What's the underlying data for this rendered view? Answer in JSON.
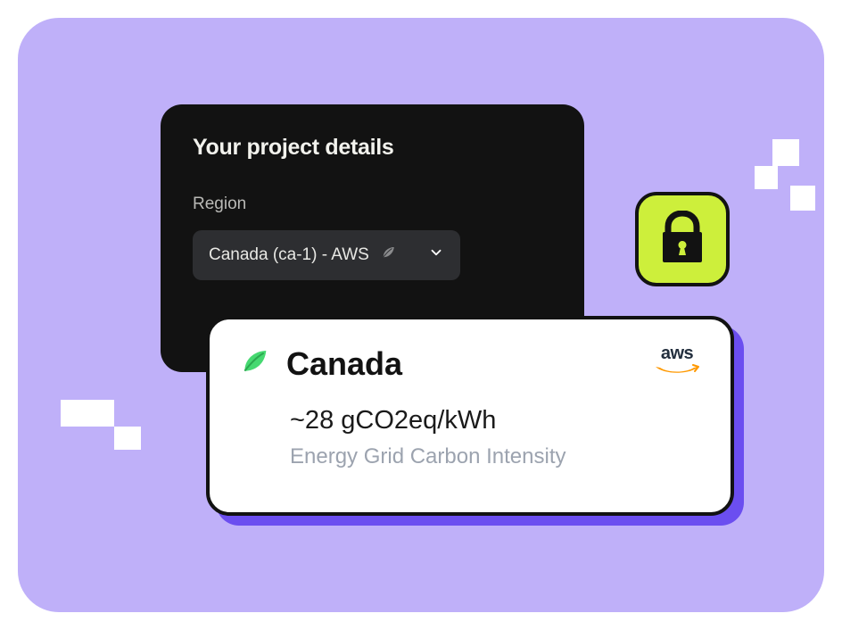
{
  "panel": {
    "title": "Your project details",
    "region_label": "Region",
    "region_value": "Canada (ca-1) - AWS"
  },
  "info": {
    "country": "Canada",
    "provider": "aws",
    "metric_value": "~28 gCO2eq/kWh",
    "metric_label": "Energy Grid Carbon Intensity"
  },
  "colors": {
    "canvas": "#bfb0f9",
    "accent": "#6b4ef0",
    "lock_bg": "#cdef3b",
    "leaf": "#46d971"
  }
}
